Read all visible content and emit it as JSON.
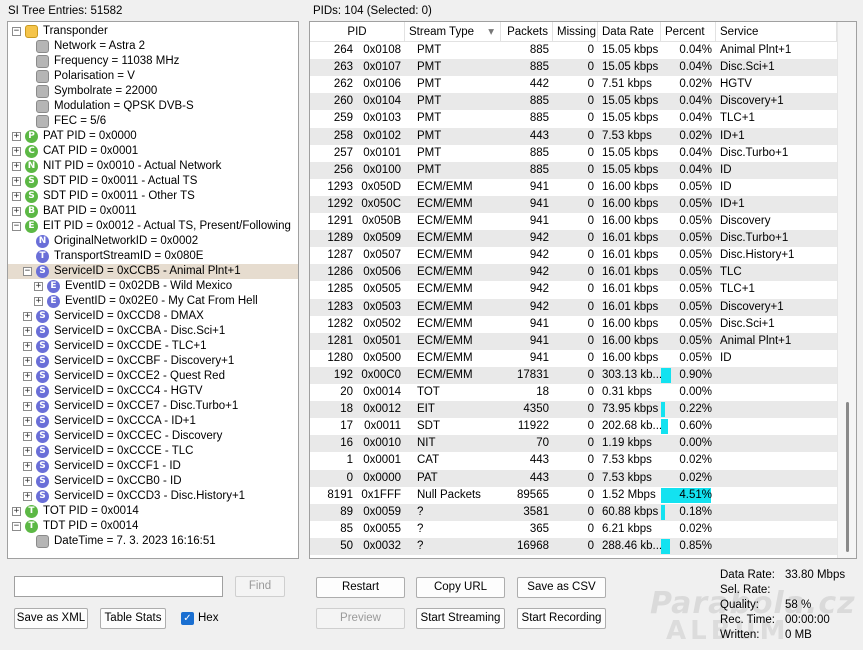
{
  "left_title": "SI Tree Entries: 51582",
  "right_title": "PIDs: 104    (Selected: 0)",
  "tree": [
    {
      "level": 0,
      "expander": "minus",
      "icon": "folder",
      "letter": "",
      "text": "Transponder"
    },
    {
      "level": 1,
      "expander": "none",
      "icon": "grey",
      "letter": "",
      "text": "Network = Astra 2"
    },
    {
      "level": 1,
      "expander": "none",
      "icon": "grey",
      "letter": "",
      "text": "Frequency = 11038 MHz"
    },
    {
      "level": 1,
      "expander": "none",
      "icon": "grey",
      "letter": "",
      "text": "Polarisation = V"
    },
    {
      "level": 1,
      "expander": "none",
      "icon": "grey",
      "letter": "",
      "text": "Symbolrate = 22000"
    },
    {
      "level": 1,
      "expander": "none",
      "icon": "grey",
      "letter": "",
      "text": "Modulation = QPSK DVB-S"
    },
    {
      "level": 1,
      "expander": "none",
      "icon": "grey",
      "letter": "",
      "text": "FEC = 5/6"
    },
    {
      "level": 0,
      "expander": "plus",
      "icon": "green",
      "letter": "P",
      "text": "PAT PID = 0x0000"
    },
    {
      "level": 0,
      "expander": "plus",
      "icon": "green",
      "letter": "C",
      "text": "CAT PID = 0x0001"
    },
    {
      "level": 0,
      "expander": "plus",
      "icon": "green",
      "letter": "N",
      "text": "NIT PID = 0x0010 - Actual Network"
    },
    {
      "level": 0,
      "expander": "plus",
      "icon": "green",
      "letter": "S",
      "text": "SDT PID = 0x0011 - Actual TS"
    },
    {
      "level": 0,
      "expander": "plus",
      "icon": "green",
      "letter": "S",
      "text": "SDT PID = 0x0011 - Other TS"
    },
    {
      "level": 0,
      "expander": "plus",
      "icon": "green",
      "letter": "B",
      "text": "BAT PID = 0x0011"
    },
    {
      "level": 0,
      "expander": "minus",
      "icon": "green",
      "letter": "E",
      "text": "EIT PID = 0x0012 - Actual TS, Present/Following"
    },
    {
      "level": 1,
      "expander": "none",
      "icon": "purple",
      "letter": "N",
      "text": "OriginalNetworkID = 0x0002"
    },
    {
      "level": 1,
      "expander": "none",
      "icon": "purple",
      "letter": "T",
      "text": "TransportStreamID = 0x080E"
    },
    {
      "level": 1,
      "expander": "minus",
      "icon": "purple",
      "letter": "S",
      "text": "ServiceID = 0xCCB5 - Animal Plnt+1",
      "selected": true
    },
    {
      "level": 2,
      "expander": "plus",
      "icon": "purple",
      "letter": "E",
      "text": "EventID = 0x02DB - Wild Mexico"
    },
    {
      "level": 2,
      "expander": "plus",
      "icon": "purple",
      "letter": "E",
      "text": "EventID = 0x02E0 - My Cat From Hell"
    },
    {
      "level": 1,
      "expander": "plus",
      "icon": "purple",
      "letter": "S",
      "text": "ServiceID = 0xCCD8 - DMAX"
    },
    {
      "level": 1,
      "expander": "plus",
      "icon": "purple",
      "letter": "S",
      "text": "ServiceID = 0xCCBA - Disc.Sci+1"
    },
    {
      "level": 1,
      "expander": "plus",
      "icon": "purple",
      "letter": "S",
      "text": "ServiceID = 0xCCDE - TLC+1"
    },
    {
      "level": 1,
      "expander": "plus",
      "icon": "purple",
      "letter": "S",
      "text": "ServiceID = 0xCCBF - Discovery+1"
    },
    {
      "level": 1,
      "expander": "plus",
      "icon": "purple",
      "letter": "S",
      "text": "ServiceID = 0xCCE2 - Quest Red"
    },
    {
      "level": 1,
      "expander": "plus",
      "icon": "purple",
      "letter": "S",
      "text": "ServiceID = 0xCCC4 - HGTV"
    },
    {
      "level": 1,
      "expander": "plus",
      "icon": "purple",
      "letter": "S",
      "text": "ServiceID = 0xCCE7 - Disc.Turbo+1"
    },
    {
      "level": 1,
      "expander": "plus",
      "icon": "purple",
      "letter": "S",
      "text": "ServiceID = 0xCCCA - ID+1"
    },
    {
      "level": 1,
      "expander": "plus",
      "icon": "purple",
      "letter": "S",
      "text": "ServiceID = 0xCCEC - Discovery"
    },
    {
      "level": 1,
      "expander": "plus",
      "icon": "purple",
      "letter": "S",
      "text": "ServiceID = 0xCCCE - TLC"
    },
    {
      "level": 1,
      "expander": "plus",
      "icon": "purple",
      "letter": "S",
      "text": "ServiceID = 0xCCF1 - ID"
    },
    {
      "level": 1,
      "expander": "plus",
      "icon": "purple",
      "letter": "S",
      "text": "ServiceID = 0xCCB0 - ID"
    },
    {
      "level": 1,
      "expander": "plus",
      "icon": "purple",
      "letter": "S",
      "text": "ServiceID = 0xCCD3 - Disc.History+1"
    },
    {
      "level": 0,
      "expander": "plus",
      "icon": "green",
      "letter": "T",
      "text": "TOT PID = 0x0014"
    },
    {
      "level": 0,
      "expander": "minus",
      "icon": "green",
      "letter": "T",
      "text": "TDT PID = 0x0014"
    },
    {
      "level": 1,
      "expander": "none",
      "icon": "grey",
      "letter": "",
      "text": "DateTime = 7. 3. 2023 16:16:51"
    }
  ],
  "find_label": "Find",
  "search_value": "",
  "save_xml_label": "Save as XML",
  "table_stats_label": "Table Stats",
  "hex_label": "Hex",
  "hex_checked": true,
  "columns": [
    "PID",
    "Stream Type",
    "Packets",
    "Missing",
    "Data Rate",
    "Percent",
    "Service"
  ],
  "sort_indicator": "▾",
  "rows": [
    {
      "pid": "264",
      "hex": "0x0108",
      "type": "PMT",
      "packets": "885",
      "missing": "0",
      "rate": "15.05 kbps",
      "pct": "0.04%",
      "bar": 0,
      "service": "Animal Plnt+1"
    },
    {
      "pid": "263",
      "hex": "0x0107",
      "type": "PMT",
      "packets": "885",
      "missing": "0",
      "rate": "15.05 kbps",
      "pct": "0.04%",
      "bar": 0,
      "service": "Disc.Sci+1"
    },
    {
      "pid": "262",
      "hex": "0x0106",
      "type": "PMT",
      "packets": "442",
      "missing": "0",
      "rate": "7.51 kbps",
      "pct": "0.02%",
      "bar": 0,
      "service": "HGTV"
    },
    {
      "pid": "260",
      "hex": "0x0104",
      "type": "PMT",
      "packets": "885",
      "missing": "0",
      "rate": "15.05 kbps",
      "pct": "0.04%",
      "bar": 0,
      "service": "Discovery+1"
    },
    {
      "pid": "259",
      "hex": "0x0103",
      "type": "PMT",
      "packets": "885",
      "missing": "0",
      "rate": "15.05 kbps",
      "pct": "0.04%",
      "bar": 0,
      "service": "TLC+1"
    },
    {
      "pid": "258",
      "hex": "0x0102",
      "type": "PMT",
      "packets": "443",
      "missing": "0",
      "rate": "7.53 kbps",
      "pct": "0.02%",
      "bar": 0,
      "service": "ID+1"
    },
    {
      "pid": "257",
      "hex": "0x0101",
      "type": "PMT",
      "packets": "885",
      "missing": "0",
      "rate": "15.05 kbps",
      "pct": "0.04%",
      "bar": 0,
      "service": "Disc.Turbo+1"
    },
    {
      "pid": "256",
      "hex": "0x0100",
      "type": "PMT",
      "packets": "885",
      "missing": "0",
      "rate": "15.05 kbps",
      "pct": "0.04%",
      "bar": 0,
      "service": "ID"
    },
    {
      "pid": "1293",
      "hex": "0x050D",
      "type": "ECM/EMM",
      "packets": "941",
      "missing": "0",
      "rate": "16.00 kbps",
      "pct": "0.05%",
      "bar": 0,
      "service": "ID"
    },
    {
      "pid": "1292",
      "hex": "0x050C",
      "type": "ECM/EMM",
      "packets": "941",
      "missing": "0",
      "rate": "16.00 kbps",
      "pct": "0.05%",
      "bar": 0,
      "service": "ID+1"
    },
    {
      "pid": "1291",
      "hex": "0x050B",
      "type": "ECM/EMM",
      "packets": "941",
      "missing": "0",
      "rate": "16.00 kbps",
      "pct": "0.05%",
      "bar": 0,
      "service": "Discovery"
    },
    {
      "pid": "1289",
      "hex": "0x0509",
      "type": "ECM/EMM",
      "packets": "942",
      "missing": "0",
      "rate": "16.01 kbps",
      "pct": "0.05%",
      "bar": 0,
      "service": "Disc.Turbo+1"
    },
    {
      "pid": "1287",
      "hex": "0x0507",
      "type": "ECM/EMM",
      "packets": "942",
      "missing": "0",
      "rate": "16.01 kbps",
      "pct": "0.05%",
      "bar": 0,
      "service": "Disc.History+1"
    },
    {
      "pid": "1286",
      "hex": "0x0506",
      "type": "ECM/EMM",
      "packets": "942",
      "missing": "0",
      "rate": "16.01 kbps",
      "pct": "0.05%",
      "bar": 0,
      "service": "TLC"
    },
    {
      "pid": "1285",
      "hex": "0x0505",
      "type": "ECM/EMM",
      "packets": "942",
      "missing": "0",
      "rate": "16.01 kbps",
      "pct": "0.05%",
      "bar": 0,
      "service": "TLC+1"
    },
    {
      "pid": "1283",
      "hex": "0x0503",
      "type": "ECM/EMM",
      "packets": "942",
      "missing": "0",
      "rate": "16.01 kbps",
      "pct": "0.05%",
      "bar": 0,
      "service": "Discovery+1"
    },
    {
      "pid": "1282",
      "hex": "0x0502",
      "type": "ECM/EMM",
      "packets": "941",
      "missing": "0",
      "rate": "16.00 kbps",
      "pct": "0.05%",
      "bar": 0,
      "service": "Disc.Sci+1"
    },
    {
      "pid": "1281",
      "hex": "0x0501",
      "type": "ECM/EMM",
      "packets": "941",
      "missing": "0",
      "rate": "16.00 kbps",
      "pct": "0.05%",
      "bar": 0,
      "service": "Animal Plnt+1"
    },
    {
      "pid": "1280",
      "hex": "0x0500",
      "type": "ECM/EMM",
      "packets": "941",
      "missing": "0",
      "rate": "16.00 kbps",
      "pct": "0.05%",
      "bar": 0,
      "service": "ID"
    },
    {
      "pid": "192",
      "hex": "0x00C0",
      "type": "ECM/EMM",
      "packets": "17831",
      "missing": "0",
      "rate": "303.13 kb...",
      "pct": "0.90%",
      "bar": 0.9,
      "service": ""
    },
    {
      "pid": "20",
      "hex": "0x0014",
      "type": "TOT",
      "packets": "18",
      "missing": "0",
      "rate": "0.31 kbps",
      "pct": "0.00%",
      "bar": 0,
      "service": ""
    },
    {
      "pid": "18",
      "hex": "0x0012",
      "type": "EIT",
      "packets": "4350",
      "missing": "0",
      "rate": "73.95 kbps",
      "pct": "0.22%",
      "bar": 0.22,
      "service": ""
    },
    {
      "pid": "17",
      "hex": "0x0011",
      "type": "SDT",
      "packets": "11922",
      "missing": "0",
      "rate": "202.68 kb...",
      "pct": "0.60%",
      "bar": 0.6,
      "service": ""
    },
    {
      "pid": "16",
      "hex": "0x0010",
      "type": "NIT",
      "packets": "70",
      "missing": "0",
      "rate": "1.19 kbps",
      "pct": "0.00%",
      "bar": 0,
      "service": ""
    },
    {
      "pid": "1",
      "hex": "0x0001",
      "type": "CAT",
      "packets": "443",
      "missing": "0",
      "rate": "7.53 kbps",
      "pct": "0.02%",
      "bar": 0,
      "service": ""
    },
    {
      "pid": "0",
      "hex": "0x0000",
      "type": "PAT",
      "packets": "443",
      "missing": "0",
      "rate": "7.53 kbps",
      "pct": "0.02%",
      "bar": 0,
      "service": ""
    },
    {
      "pid": "8191",
      "hex": "0x1FFF",
      "type": "Null Packets",
      "packets": "89565",
      "missing": "0",
      "rate": "1.52 Mbps",
      "pct": "4.51%",
      "bar": 4.51,
      "service": ""
    },
    {
      "pid": "89",
      "hex": "0x0059",
      "type": "?",
      "packets": "3581",
      "missing": "0",
      "rate": "60.88 kbps",
      "pct": "0.18%",
      "bar": 0.18,
      "service": ""
    },
    {
      "pid": "85",
      "hex": "0x0055",
      "type": "?",
      "packets": "365",
      "missing": "0",
      "rate": "6.21 kbps",
      "pct": "0.02%",
      "bar": 0,
      "service": ""
    },
    {
      "pid": "50",
      "hex": "0x0032",
      "type": "?",
      "packets": "16968",
      "missing": "0",
      "rate": "288.46 kb...",
      "pct": "0.85%",
      "bar": 0.85,
      "service": ""
    }
  ],
  "buttons": {
    "restart": "Restart",
    "copy_url": "Copy URL",
    "save_csv": "Save as CSV",
    "preview": "Preview",
    "start_streaming": "Start Streaming",
    "start_recording": "Start Recording"
  },
  "stats": [
    {
      "key": "Data Rate:",
      "value": "33.80 Mbps"
    },
    {
      "key": "Sel. Rate:",
      "value": ""
    },
    {
      "key": "Quality:",
      "value": "58 %"
    },
    {
      "key": "Rec. Time:",
      "value": "00:00:00"
    },
    {
      "key": "Written:",
      "value": "0 MB"
    }
  ],
  "watermark_line1": "Parabola.cz",
  "watermark_line2": "ALBUM",
  "colors": {
    "selected_row": "#e6dccf",
    "percent_bar": "#13e2f0",
    "alt_row": "#e9e9e9"
  }
}
